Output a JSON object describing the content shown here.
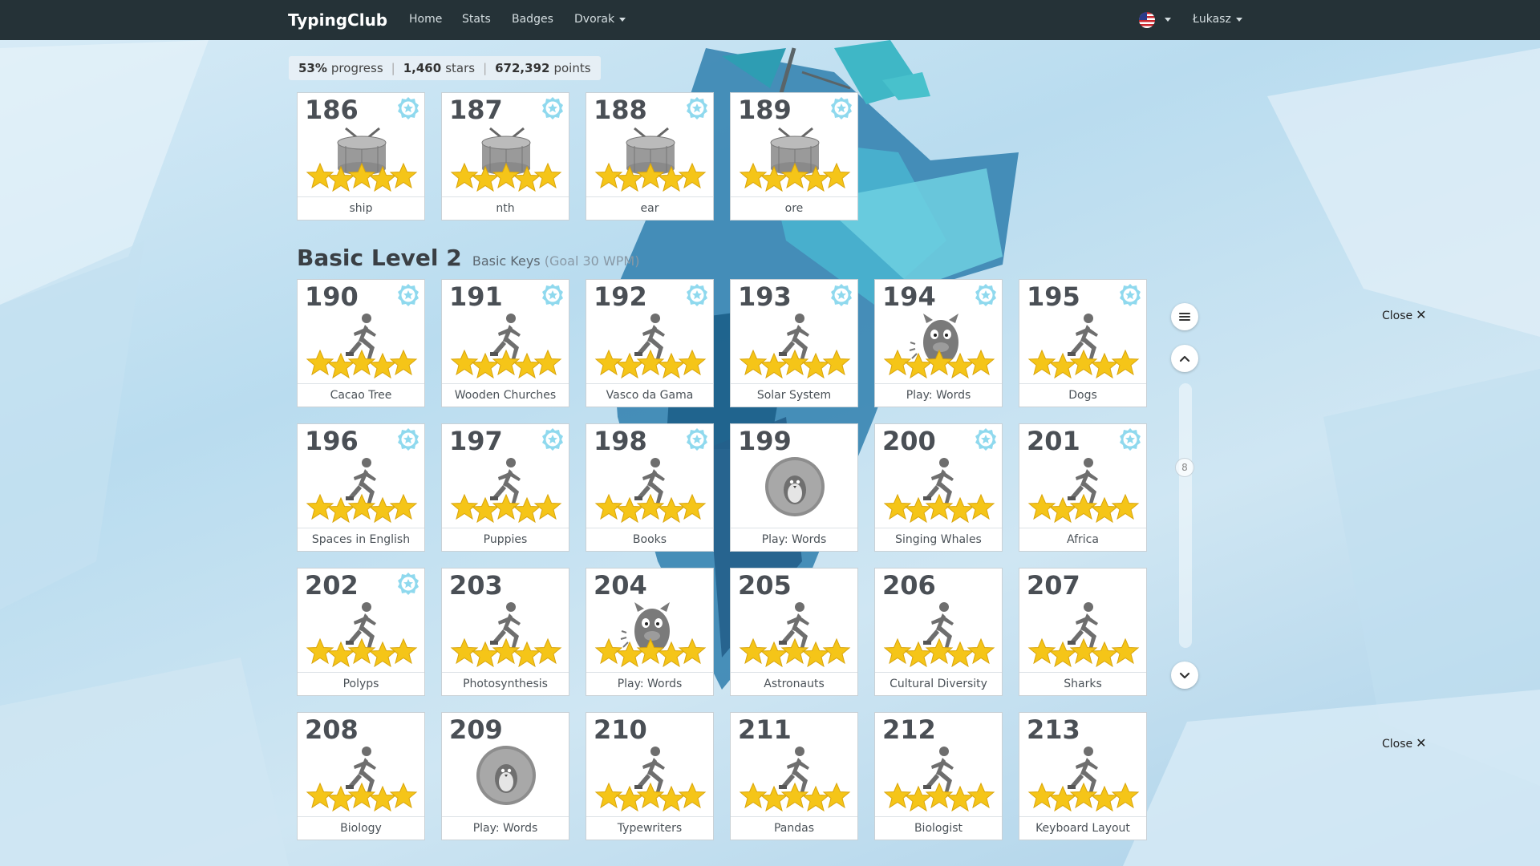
{
  "topbar": {
    "brand": "TypingClub",
    "nav": [
      {
        "label": "Home"
      },
      {
        "label": "Stats"
      },
      {
        "label": "Badges"
      },
      {
        "label": "Dvorak"
      }
    ],
    "language_flag": "us-flag-icon",
    "user": "Łukasz"
  },
  "stats": {
    "progress_value": "53%",
    "progress_label": "progress",
    "stars_value": "1,460",
    "stars_label": "stars",
    "points_value": "672,392",
    "points_label": "points"
  },
  "section": {
    "title": "Basic Level 2",
    "subtitle": "Basic Keys",
    "goal": "(Goal 30 WPM)"
  },
  "lessons": [
    {
      "num": "186",
      "label": "ship",
      "art": "drum-icon",
      "stars": 5,
      "badge": true
    },
    {
      "num": "187",
      "label": "nth",
      "art": "drum-icon",
      "stars": 5,
      "badge": true
    },
    {
      "num": "188",
      "label": "ear",
      "art": "drum-icon",
      "stars": 5,
      "badge": true
    },
    {
      "num": "189",
      "label": "ore",
      "art": "drum-icon",
      "stars": 5,
      "badge": true
    },
    {
      "num": "190",
      "label": "Cacao Tree",
      "art": "runner-icon",
      "stars": 5,
      "badge": true
    },
    {
      "num": "191",
      "label": "Wooden Churches",
      "art": "runner-icon",
      "stars": 5,
      "badge": true
    },
    {
      "num": "192",
      "label": "Vasco da Gama",
      "art": "runner-icon",
      "stars": 5,
      "badge": true
    },
    {
      "num": "193",
      "label": "Solar System",
      "art": "runner-icon",
      "stars": 5,
      "badge": true
    },
    {
      "num": "194",
      "label": "Play: Words",
      "art": "monster-icon",
      "stars": 5,
      "badge": true
    },
    {
      "num": "195",
      "label": "Dogs",
      "art": "runner-icon",
      "stars": 5,
      "badge": true
    },
    {
      "num": "196",
      "label": "Spaces in English",
      "art": "runner-icon",
      "stars": 5,
      "badge": true
    },
    {
      "num": "197",
      "label": "Puppies",
      "art": "runner-icon",
      "stars": 5,
      "badge": true
    },
    {
      "num": "198",
      "label": "Books",
      "art": "runner-icon",
      "stars": 5,
      "badge": true
    },
    {
      "num": "199",
      "label": "Play: Words",
      "art": "penguin-ball-icon",
      "stars": 0,
      "badge": false
    },
    {
      "num": "200",
      "label": "Singing Whales",
      "art": "runner-icon",
      "stars": 5,
      "badge": true
    },
    {
      "num": "201",
      "label": "Africa",
      "art": "runner-icon",
      "stars": 5,
      "badge": true
    },
    {
      "num": "202",
      "label": "Polyps",
      "art": "runner-icon",
      "stars": 5,
      "badge": true
    },
    {
      "num": "203",
      "label": "Photosynthesis",
      "art": "runner-icon",
      "stars": 5,
      "badge": false
    },
    {
      "num": "204",
      "label": "Play: Words",
      "art": "monster-icon",
      "stars": 5,
      "badge": false
    },
    {
      "num": "205",
      "label": "Astronauts",
      "art": "runner-icon",
      "stars": 5,
      "badge": false
    },
    {
      "num": "206",
      "label": "Cultural Diversity",
      "art": "runner-icon",
      "stars": 5,
      "badge": false
    },
    {
      "num": "207",
      "label": "Sharks",
      "art": "runner-icon",
      "stars": 5,
      "badge": false
    },
    {
      "num": "208",
      "label": "Biology",
      "art": "runner-icon",
      "stars": 5,
      "badge": false
    },
    {
      "num": "209",
      "label": "Play: Words",
      "art": "penguin-ball-icon",
      "stars": 0,
      "badge": false
    },
    {
      "num": "210",
      "label": "Typewriters",
      "art": "runner-icon",
      "stars": 5,
      "badge": false
    },
    {
      "num": "211",
      "label": "Pandas",
      "art": "runner-icon",
      "stars": 5,
      "badge": false
    },
    {
      "num": "212",
      "label": "Biologist",
      "art": "runner-icon",
      "stars": 5,
      "badge": false
    },
    {
      "num": "213",
      "label": "Keyboard Layout",
      "art": "runner-icon",
      "stars": 5,
      "badge": false
    }
  ],
  "side": {
    "menu_icon": "menu-icon",
    "up_icon": "chevron-up-icon",
    "down_icon": "chevron-down-icon",
    "scroll_value": "8",
    "close_label": "Close",
    "close_icon": "close-icon"
  },
  "colors": {
    "topbar": "#253237",
    "star": "#f5c518",
    "badge": "#7fd3ea"
  }
}
